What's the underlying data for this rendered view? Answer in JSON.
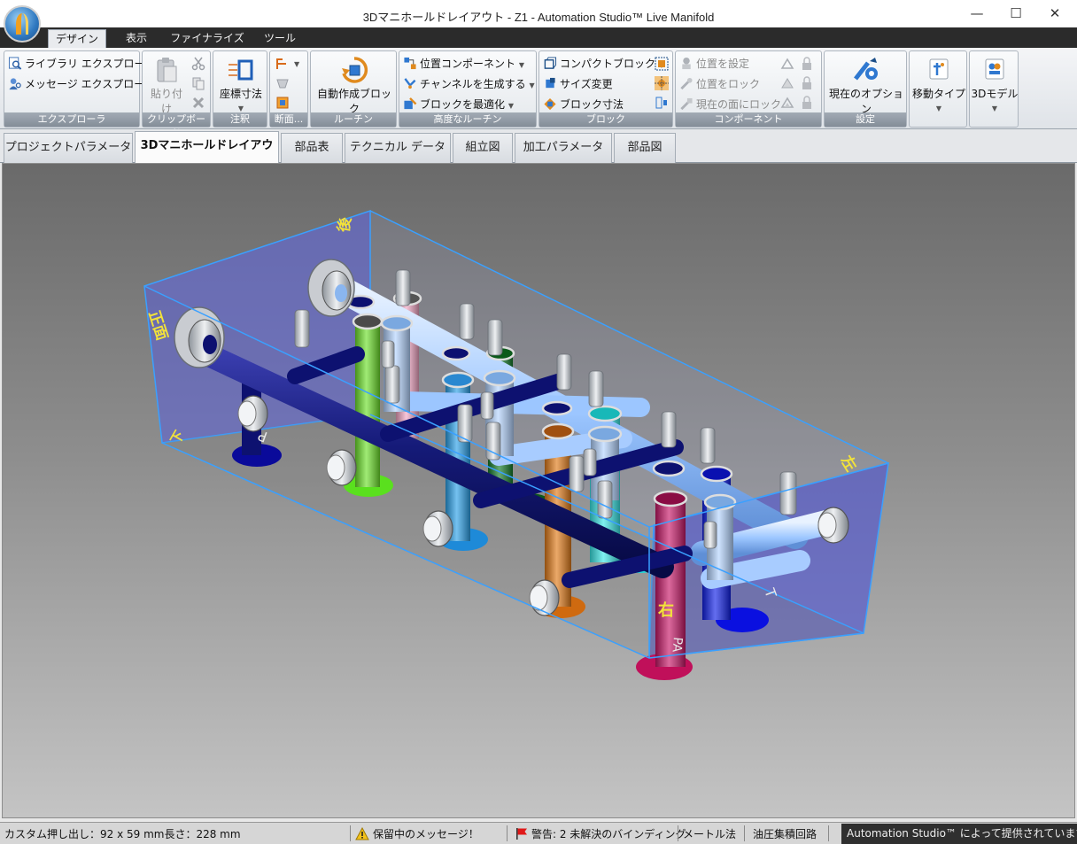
{
  "window": {
    "title": "3Dマニホールドレイアウト - Z1 - Automation Studio™ Live Manifold",
    "minimize_glyph": "—",
    "maximize_glyph": "☐",
    "close_glyph": "✕"
  },
  "ribbon_tabs": [
    "デザイン",
    "表示",
    "ファイナライズ",
    "ツール"
  ],
  "ribbon": {
    "explorer": {
      "library": "ライブラリ エクスプローラ",
      "message": "メッセージ エクスプローラ",
      "label": "エクスプローラ"
    },
    "clipboard": {
      "paste": "貼り付け",
      "label": "クリップボード"
    },
    "annotation": {
      "coordinate_dim": "座標寸法",
      "label": "注釈"
    },
    "section": {
      "label": "断面..."
    },
    "routine": {
      "auto_block": "自動作成ブロック",
      "label": "ルーチン"
    },
    "advanced": {
      "position_component": "位置コンポーネント",
      "generate_channel": "チャンネルを生成する",
      "optimize_block": "ブロックを最適化",
      "label": "高度なルーチン"
    },
    "block": {
      "compact_block": "コンパクトブロック",
      "resize": "サイズ変更",
      "block_dim": "ブロック寸法",
      "label": "ブロック"
    },
    "component": {
      "set_position": "位置を設定",
      "lock_position": "位置をロック",
      "lock_face": "現在の面にロック",
      "label": "コンポーネント"
    },
    "settings": {
      "current_options": "現在のオプション",
      "label": "設定"
    },
    "move_type": "移動タイプ",
    "model_3d": "3Dモデル"
  },
  "doc_tabs": [
    "プロジェクトパラメータ",
    "3Dマニホールドレイアウト",
    "部品表",
    "テクニカル データ",
    "組立図",
    "加工パラメータ",
    "部品図"
  ],
  "viewport": {
    "face_labels": {
      "front": "正面",
      "back": "後",
      "right": "右",
      "left": "左",
      "bottom": "下"
    },
    "port_labels": {
      "p": "P",
      "t": "T",
      "pa": "PA"
    },
    "colors": {
      "block_edge": "#3aa0ff",
      "face_tint": "#5a5fd8",
      "label_color": "#f2e23a"
    }
  },
  "status": {
    "extrusion": "カスタム押し出し：92 x 59 mm長さ：228 mm",
    "pending": "保留中のメッセージ！",
    "warning": "警告: 2 未解決のバインディング",
    "units": "メートル法",
    "circuit": "油圧集積回路",
    "brand": "Automation Studio™ によって提供されています"
  }
}
